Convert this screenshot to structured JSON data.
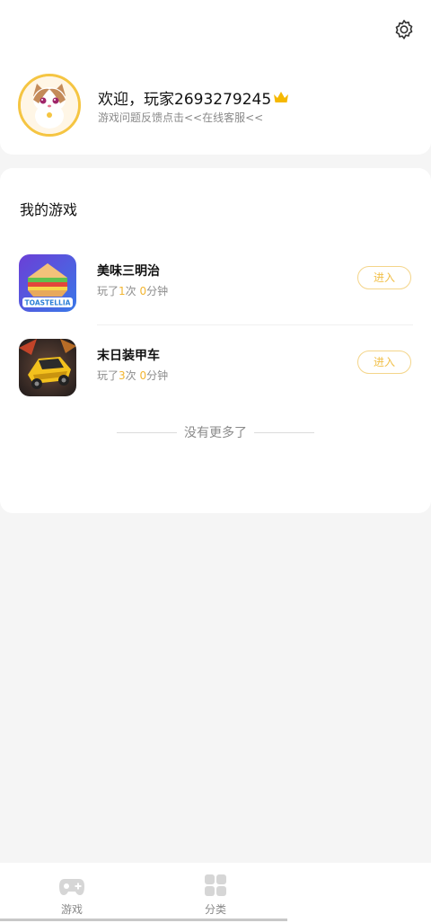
{
  "header": {
    "welcome_text": "欢迎，玩家2693279245",
    "feedback_text": "游戏问题反馈点击<<在线客服<<"
  },
  "my_games": {
    "title": "我的游戏",
    "games": [
      {
        "name": "美味三明治",
        "stats_prefix": "玩了",
        "play_count": "1",
        "count_unit": "次",
        "minutes": "0",
        "minutes_unit": "分钟",
        "enter_label": "进入",
        "icon_text": "TOASTELLIA"
      },
      {
        "name": "末日装甲车",
        "stats_prefix": "玩了",
        "play_count": "3",
        "count_unit": "次",
        "minutes": "0",
        "minutes_unit": "分钟",
        "enter_label": "进入"
      }
    ],
    "no_more_text": "没有更多了"
  },
  "tabbar": {
    "tabs": [
      {
        "label": "游戏",
        "icon": "gamepad-icon"
      },
      {
        "label": "分类",
        "icon": "grid-icon"
      }
    ]
  },
  "colors": {
    "accent": "#f2b531",
    "button_border": "#f4d58a",
    "crown": "#f5b800"
  }
}
